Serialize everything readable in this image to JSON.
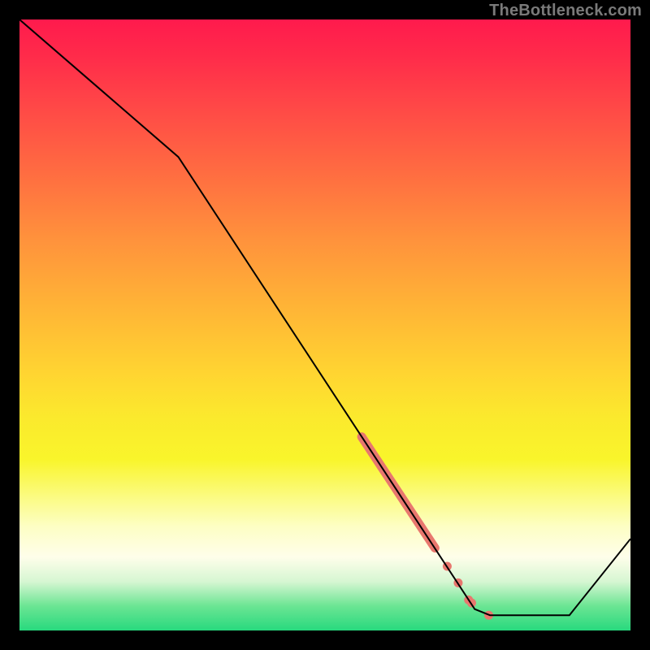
{
  "attribution": "TheBottleneck.com",
  "chart_data": {
    "type": "line",
    "title": "",
    "xlabel": "",
    "ylabel": "",
    "x_range_frac": [
      0,
      1
    ],
    "y_range_frac": [
      0,
      1
    ],
    "curve_xy_frac": [
      [
        0.0,
        0.0
      ],
      [
        0.26,
        0.225
      ],
      [
        0.745,
        0.965
      ],
      [
        0.77,
        0.975
      ],
      [
        0.9,
        0.975
      ],
      [
        1.0,
        0.85
      ]
    ],
    "highlight1_xy_frac": [
      [
        0.56,
        0.683
      ],
      [
        0.68,
        0.865
      ]
    ],
    "dots_xy_frac": [
      [
        0.7,
        0.895
      ],
      [
        0.718,
        0.922
      ],
      [
        0.735,
        0.95
      ],
      [
        0.74,
        0.955
      ],
      [
        0.768,
        0.975
      ]
    ],
    "colors": {
      "curve": "#000000",
      "highlight": "#e8776e",
      "dot": "#e8776e"
    }
  }
}
